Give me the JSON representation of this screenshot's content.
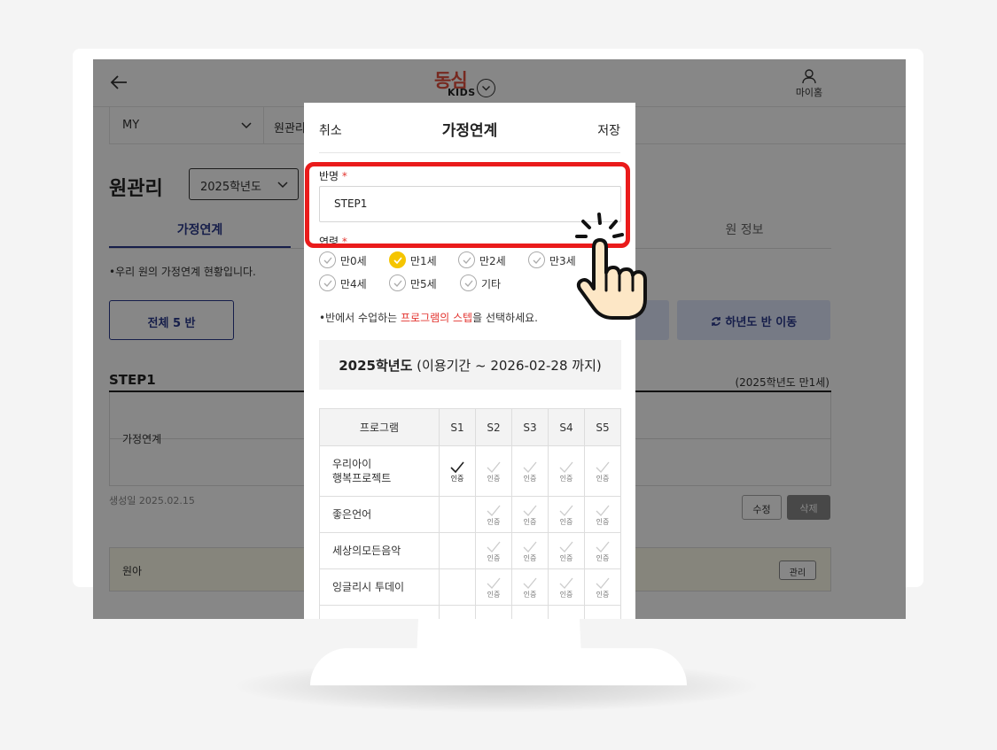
{
  "header": {
    "logo_text": "동심",
    "logo_sub": "KIDS",
    "my_home_label": "마이홈"
  },
  "subnav": {
    "selected": "MY",
    "second_item": "원관리"
  },
  "page": {
    "title": "원관리",
    "year_select": "2025학년도",
    "tabs": [
      {
        "label": "가정연계",
        "active": true
      },
      {
        "label": "원 정보",
        "active": false
      }
    ],
    "notice": "•우리 원의 가정연계 현황입니다.",
    "total_button": "전체 5 반",
    "move_button": "하년도 반 이동",
    "class_title": "STEP1",
    "class_note": "(2025학년도 만1세)",
    "class_box_label": "가정연계",
    "created_date": "생성일 2025.02.15",
    "edit_button": "수정",
    "delete_button": "삭제",
    "kids_label": "원아",
    "manage_button": "관리"
  },
  "modal": {
    "cancel": "취소",
    "title": "가정연계",
    "save": "저장",
    "class_name_label": "반명",
    "required_mark": "*",
    "class_name_value": "STEP1",
    "age_label": "연령",
    "ages": [
      {
        "label": "만0세",
        "checked": false
      },
      {
        "label": "만1세",
        "checked": true
      },
      {
        "label": "만2세",
        "checked": false
      },
      {
        "label": "만3세",
        "checked": false
      },
      {
        "label": "만4세",
        "checked": false
      },
      {
        "label": "만5세",
        "checked": false
      },
      {
        "label": "기타",
        "checked": false
      }
    ],
    "step_notice_pre": "•반에서 수업하는 ",
    "step_notice_highlight": "프로그램의 스텝",
    "step_notice_post": "을 선택하세요.",
    "period_year": "2025학년도",
    "period_rest": " (이용기간 ~ 2026-02-28 까지)",
    "table": {
      "headers": [
        "프로그램",
        "S1",
        "S2",
        "S3",
        "S4",
        "S5"
      ],
      "cert_label": "인증",
      "rows": [
        {
          "name_line1": "우리아이",
          "name_line2": "행복프로젝트",
          "steps": [
            "on",
            "off",
            "off",
            "off",
            "off"
          ]
        },
        {
          "name_line1": "좋은언어",
          "name_line2": "",
          "steps": [
            "none",
            "off",
            "off",
            "off",
            "off"
          ]
        },
        {
          "name_line1": "세상의모든음악",
          "name_line2": "",
          "steps": [
            "none",
            "off",
            "off",
            "off",
            "off"
          ]
        },
        {
          "name_line1": "잉글리시 투데이",
          "name_line2": "",
          "steps": [
            "none",
            "off",
            "off",
            "off",
            "off"
          ]
        }
      ]
    }
  },
  "colors": {
    "highlight": "#ea1b1b",
    "accent_navy": "#2b3a8c",
    "checked_yellow": "#f5c500",
    "hand_fill": "#fde7c6"
  },
  "icons": [
    "back-arrow-icon",
    "chevron-down-icon",
    "person-icon",
    "check-icon",
    "refresh-icon",
    "pointing-hand-icon"
  ]
}
